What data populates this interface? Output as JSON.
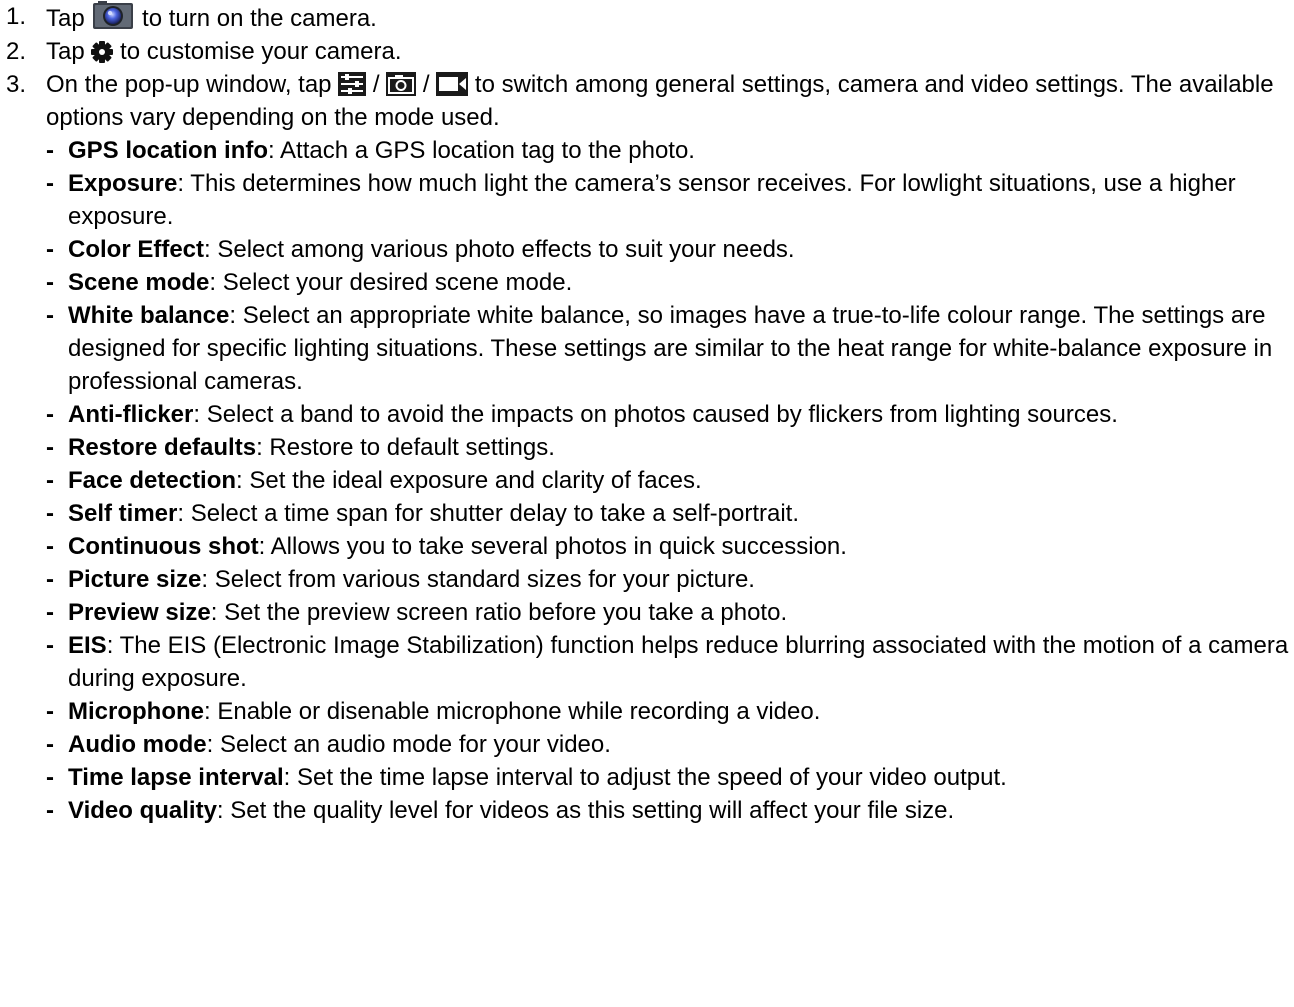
{
  "steps": [
    {
      "number": "1.",
      "before": "Tap",
      "icon": "camera-app-icon",
      "after": "to turn on the camera."
    },
    {
      "number": "2.",
      "before": "Tap",
      "icon": "gear-icon",
      "after": "to customise your camera."
    },
    {
      "number": "3.",
      "before": "On the pop-up window, tap",
      "icons": [
        "general-settings-icon",
        "camera-settings-icon",
        "video-settings-icon"
      ],
      "separator": "/",
      "after": "to switch among general settings, camera and video settings. The available options vary depending on the mode used."
    }
  ],
  "bullet_dash": "-",
  "term_separator": ":",
  "settings": [
    {
      "term": "GPS location info",
      "desc": " Attach a GPS location tag to the photo."
    },
    {
      "term": "Exposure",
      "desc": " This determines how much light the camera’s sensor receives. For lowlight situations, use a higher exposure."
    },
    {
      "term": "Color Effect",
      "desc": " Select among various photo effects to suit your needs."
    },
    {
      "term": "Scene mode",
      "desc": " Select your desired scene mode."
    },
    {
      "term": "White balance",
      "desc": " Select an appropriate white balance, so images have a true-to-life colour range. The settings are designed for specific lighting situations. These settings are similar to the heat range for white-balance exposure in professional cameras."
    },
    {
      "term": "Anti-flicker",
      "desc": " Select a band to avoid the impacts on photos caused by flickers from lighting sources."
    },
    {
      "term": "Restore defaults",
      "desc": " Restore to default settings."
    },
    {
      "term": "Face detection",
      "desc": " Set the ideal exposure and clarity of faces."
    },
    {
      "term": "Self timer",
      "desc": " Select a time span for shutter delay to take a self-portrait."
    },
    {
      "term": "Continuous shot",
      "desc": " Allows you to take several photos in quick succession."
    },
    {
      "term": "Picture size",
      "desc": " Select from various standard sizes for your picture."
    },
    {
      "term": "Preview size",
      "desc": " Set the preview screen ratio before you take a photo."
    },
    {
      "term": "EIS",
      "desc": " The EIS (Electronic Image Stabilization) function helps reduce blurring associated with the motion of a camera during exposure."
    },
    {
      "term": "Microphone",
      "desc": " Enable or disenable microphone while recording a video."
    },
    {
      "term": "Audio mode",
      "desc": " Select an audio mode for your video."
    },
    {
      "term": "Time lapse interval",
      "desc": " Set the time lapse interval to adjust the speed of your video output."
    },
    {
      "term": "Video quality",
      "desc": " Set the quality level for videos as this setting will affect your file size."
    }
  ]
}
